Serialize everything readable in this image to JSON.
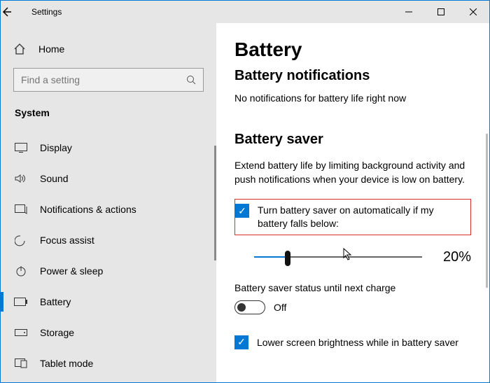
{
  "window": {
    "title": "Settings"
  },
  "sidebar": {
    "home": "Home",
    "search_placeholder": "Find a setting",
    "group": "System",
    "items": [
      {
        "label": "Display"
      },
      {
        "label": "Sound"
      },
      {
        "label": "Notifications & actions"
      },
      {
        "label": "Focus assist"
      },
      {
        "label": "Power & sleep"
      },
      {
        "label": "Battery",
        "selected": true
      },
      {
        "label": "Storage"
      },
      {
        "label": "Tablet mode"
      }
    ]
  },
  "main": {
    "h1": "Battery",
    "h2": "Battery notifications",
    "note": "No notifications for battery life right now",
    "saver_h": "Battery saver",
    "saver_desc": "Extend battery life by limiting background activity and push notifications when your device is low on battery.",
    "auto_label": "Turn battery saver on automatically if my battery falls below:",
    "slider_pct": "20%",
    "status_label": "Battery saver status until next charge",
    "toggle_state": "Off",
    "brightness_label": "Lower screen brightness while in battery saver"
  }
}
